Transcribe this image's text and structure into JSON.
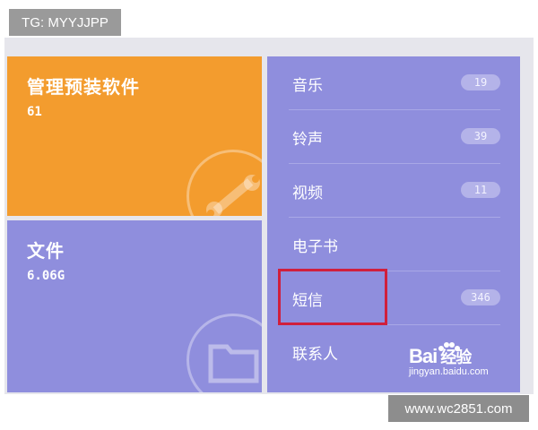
{
  "overlay_badge": {
    "text": "TG: MYYJJPP"
  },
  "tiles": {
    "preinstalled": {
      "title": "管理预装软件",
      "value": "61"
    },
    "files": {
      "title": "文件",
      "value": "6.06G"
    }
  },
  "categories": [
    {
      "label": "音乐",
      "count": "19"
    },
    {
      "label": "铃声",
      "count": "39"
    },
    {
      "label": "视频",
      "count": "11"
    },
    {
      "label": "电子书",
      "count": ""
    },
    {
      "label": "短信",
      "count": "346"
    },
    {
      "label": "联系人",
      "count": ""
    }
  ],
  "watermark": {
    "brand": "Bai",
    "brand_cn": "经验",
    "url": "jingyan.baidu.com"
  },
  "site_badge": {
    "text": "www.wc2851.com"
  },
  "colors": {
    "orange_tile": "#f39c2e",
    "purple_tile": "#8f8edd",
    "highlight": "#d01f3c"
  },
  "icons": {
    "preinstalled": "wrench-icon",
    "files": "folder-icon"
  }
}
